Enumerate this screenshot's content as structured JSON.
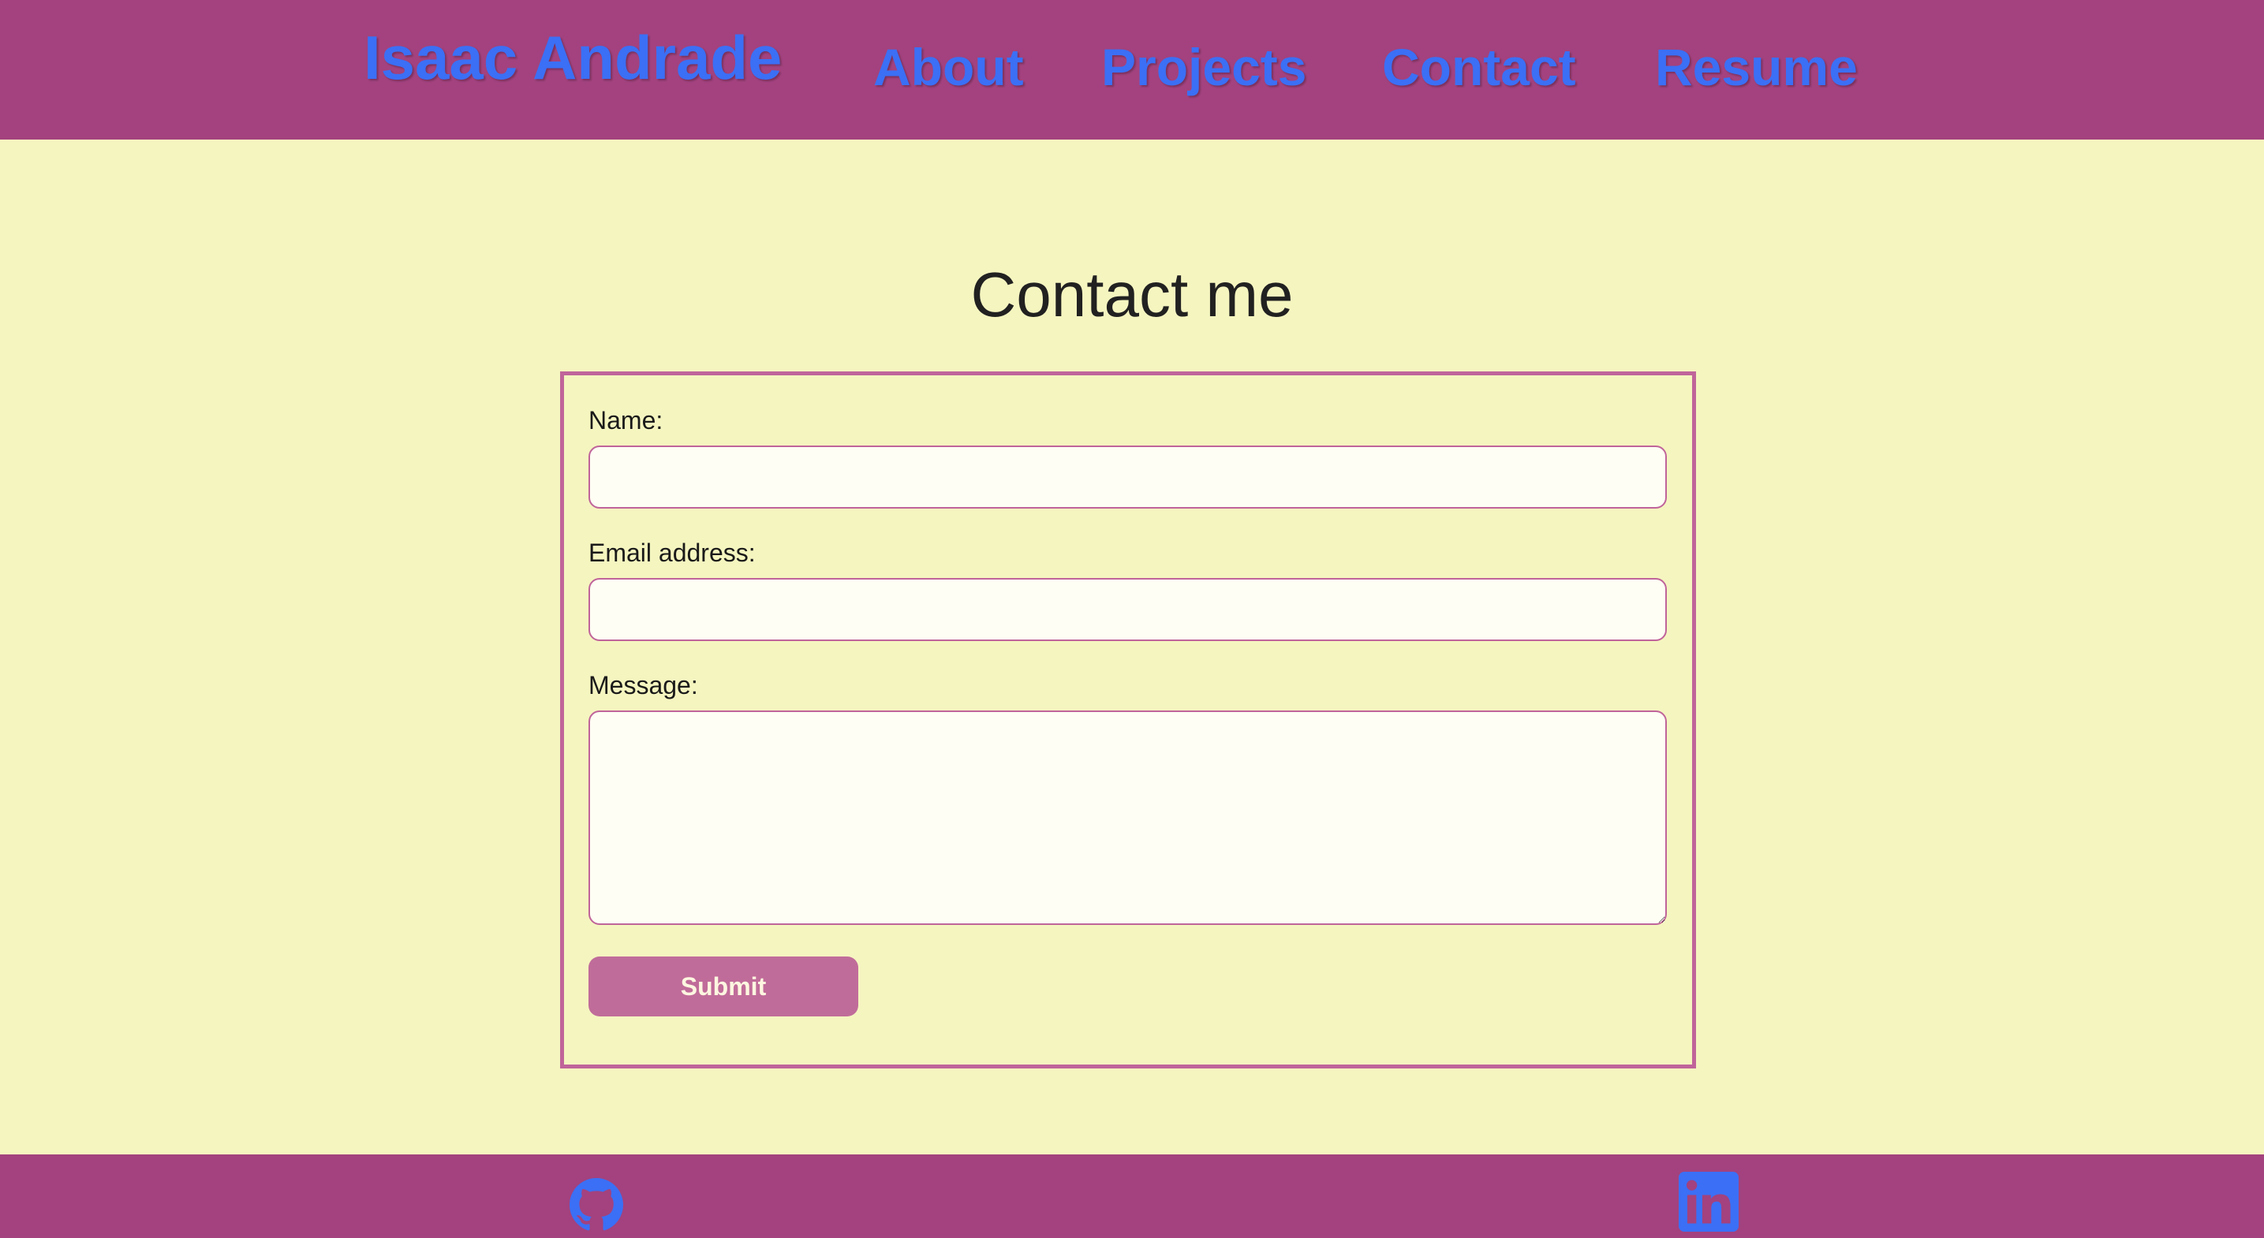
{
  "header": {
    "brand": "Isaac Andrade",
    "nav": {
      "about": "About",
      "projects": "Projects",
      "contact": "Contact",
      "resume": "Resume"
    }
  },
  "main": {
    "title": "Contact me",
    "form": {
      "name_label": "Name:",
      "name_value": "",
      "email_label": "Email address:",
      "email_value": "",
      "message_label": "Message:",
      "message_value": "",
      "submit_label": "Submit"
    }
  },
  "footer": {
    "icons": [
      "github-icon",
      "linkedin-icon"
    ]
  },
  "colors": {
    "header_bg": "#a3427e",
    "page_bg": "#f5f5c0",
    "link": "#3b6ff5",
    "accent": "#c0649a",
    "button": "#c06c9a"
  }
}
